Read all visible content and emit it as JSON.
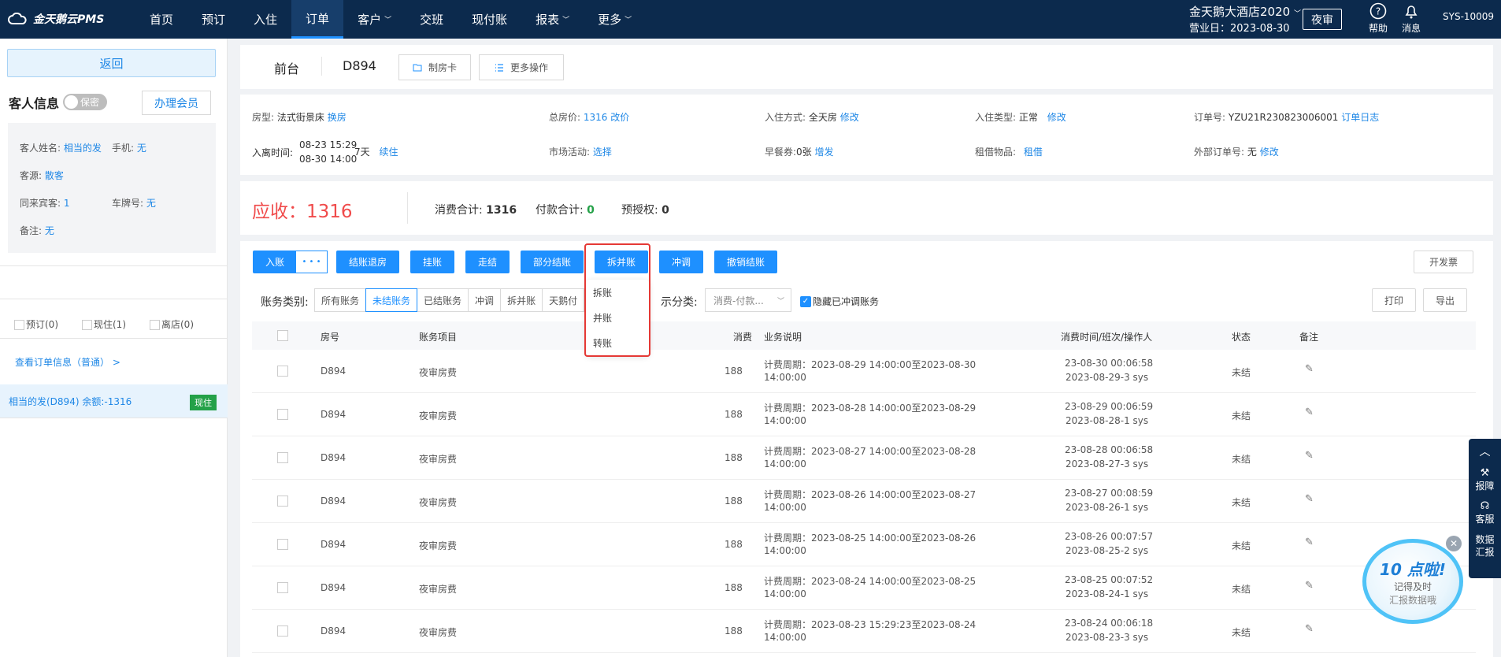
{
  "logo": "金天鹅云PMS",
  "nav": [
    "首页",
    "预订",
    "入住",
    "订单",
    "客户",
    "交班",
    "现付账",
    "报表",
    "更多"
  ],
  "nav_has_chevron": [
    false,
    false,
    false,
    false,
    true,
    false,
    false,
    true,
    true
  ],
  "nav_active": 3,
  "hotel_name": "金天鹅大酒店2020",
  "business_date": "营业日：2023-08-30",
  "night_audit": "夜审",
  "help": "帮助",
  "messages": "消息",
  "user": "SYS-10009",
  "left": {
    "back": "返回",
    "guest_info_title": "客人信息",
    "secret_toggle": "保密",
    "member_button": "办理会员",
    "guest_name_label": "客人姓名:",
    "guest_name": "相当的发",
    "phone_label": "手机:",
    "phone": "无",
    "source_label": "客源:",
    "source": "散客",
    "companions_label": "同来宾客:",
    "companions": "1",
    "plate_label": "车牌号:",
    "plate": "无",
    "remark_label": "备注:",
    "remark": "无",
    "filters": [
      "预订(0)",
      "现住(1)",
      "离店(0)"
    ],
    "view_order": "查看订单信息（普通）  >",
    "guest_item": "相当的发(D894)  余额:-1316",
    "guest_status": "现住"
  },
  "header": {
    "front_desk": "前台",
    "room": "D894",
    "make_card": "制房卡",
    "more_ops": "更多操作"
  },
  "info": {
    "room_type_label": "房型:",
    "room_type": "法式街景床",
    "change_room": "换房",
    "total_price_label": "总房价:",
    "total_price": "1316",
    "change_price": "改价",
    "checkin_mode_label": "入住方式:",
    "checkin_mode": "全天房",
    "modify": "修改",
    "checkin_type_label": "入住类型:",
    "checkin_type": "正常",
    "order_no_label": "订单号:",
    "order_no": "YZU21R230823006001",
    "order_log": "订单日志",
    "stay_label": "入离时间:",
    "stay_in": "08-23 15:29",
    "stay_out": "08-30 14:00",
    "nights": "7天",
    "extend": "续住",
    "market_label": "市场活动:",
    "market": "选择",
    "breakfast_label": "早餐券:",
    "breakfast": "0张",
    "breakfast_add": "增发",
    "rental_label": "租借物品:",
    "rental": "租借",
    "ext_order_label": "外部订单号:",
    "ext_order": "无",
    "ext_modify": "修改"
  },
  "summary": {
    "receivable": "应收：1316",
    "consume_label": "消费合计:",
    "consume": "1316",
    "payment_label": "付款合计:",
    "payment": "0",
    "preauth_label": "预授权:",
    "preauth": "0"
  },
  "actions": {
    "post": "入账",
    "more": "• • •",
    "checkout_refund": "结账退房",
    "hang": "挂账",
    "leave": "走结",
    "partial": "部分结账",
    "split_merge": "拆并账",
    "reverse": "冲调",
    "cancel_checkout": "撤销结账",
    "invoice": "开发票",
    "print": "打印",
    "export": "导出"
  },
  "dropdown": [
    "拆账",
    "并账",
    "转账"
  ],
  "filter": {
    "category_label": "账务类别:",
    "categories": [
      "所有账务",
      "未结账务",
      "已结账务",
      "冲调",
      "拆并账",
      "天鹅付"
    ],
    "active_category": 1,
    "display_label": "示分类:",
    "display_select": "消费-付款...",
    "hide_reversed": "隐藏已冲调账务"
  },
  "table": {
    "headers": [
      "房号",
      "账务项目",
      "消费",
      "业务说明",
      "消费时间/班次/操作人",
      "状态",
      "备注"
    ],
    "rows": [
      {
        "room": "D894",
        "item": "夜审房费",
        "amount": "188",
        "desc1": "计费周期：2023-08-29 14:00:00至2023-08-30",
        "desc2": "14:00:00",
        "time1": "23-08-30 00:06:58",
        "time2": "2023-08-29-3 sys",
        "status": "未结"
      },
      {
        "room": "D894",
        "item": "夜审房费",
        "amount": "188",
        "desc1": "计费周期：2023-08-28 14:00:00至2023-08-29",
        "desc2": "14:00:00",
        "time1": "23-08-29 00:06:59",
        "time2": "2023-08-28-1 sys",
        "status": "未结"
      },
      {
        "room": "D894",
        "item": "夜审房费",
        "amount": "188",
        "desc1": "计费周期：2023-08-27 14:00:00至2023-08-28",
        "desc2": "14:00:00",
        "time1": "23-08-28 00:06:58",
        "time2": "2023-08-27-3 sys",
        "status": "未结"
      },
      {
        "room": "D894",
        "item": "夜审房费",
        "amount": "188",
        "desc1": "计费周期：2023-08-26 14:00:00至2023-08-27",
        "desc2": "14:00:00",
        "time1": "23-08-27 00:08:59",
        "time2": "2023-08-26-1 sys",
        "status": "未结"
      },
      {
        "room": "D894",
        "item": "夜审房费",
        "amount": "188",
        "desc1": "计费周期：2023-08-25 14:00:00至2023-08-26",
        "desc2": "14:00:00",
        "time1": "23-08-26 00:07:57",
        "time2": "2023-08-25-2 sys",
        "status": "未结"
      },
      {
        "room": "D894",
        "item": "夜审房费",
        "amount": "188",
        "desc1": "计费周期：2023-08-24 14:00:00至2023-08-25",
        "desc2": "14:00:00",
        "time1": "23-08-25 00:07:52",
        "time2": "2023-08-24-1 sys",
        "status": "未结"
      },
      {
        "room": "D894",
        "item": "夜审房费",
        "amount": "188",
        "desc1": "计费周期：2023-08-23 15:29:23至2023-08-24",
        "desc2": "14:00:00",
        "time1": "23-08-24 00:06:18",
        "time2": "2023-08-23-3 sys",
        "status": "未结"
      }
    ]
  },
  "side": {
    "report": "报障",
    "service": "客服",
    "data1": "数据",
    "data2": "汇报"
  },
  "promo": {
    "title": "10 点啦!",
    "line1": "记得及时",
    "line2": "汇报数据哦"
  },
  "colors": {
    "nav_bg": "#0c2a4d",
    "accent": "#1e90ff",
    "receivable": "#f04b4b",
    "status_green": "#24a148",
    "highlight": "#e53935"
  }
}
